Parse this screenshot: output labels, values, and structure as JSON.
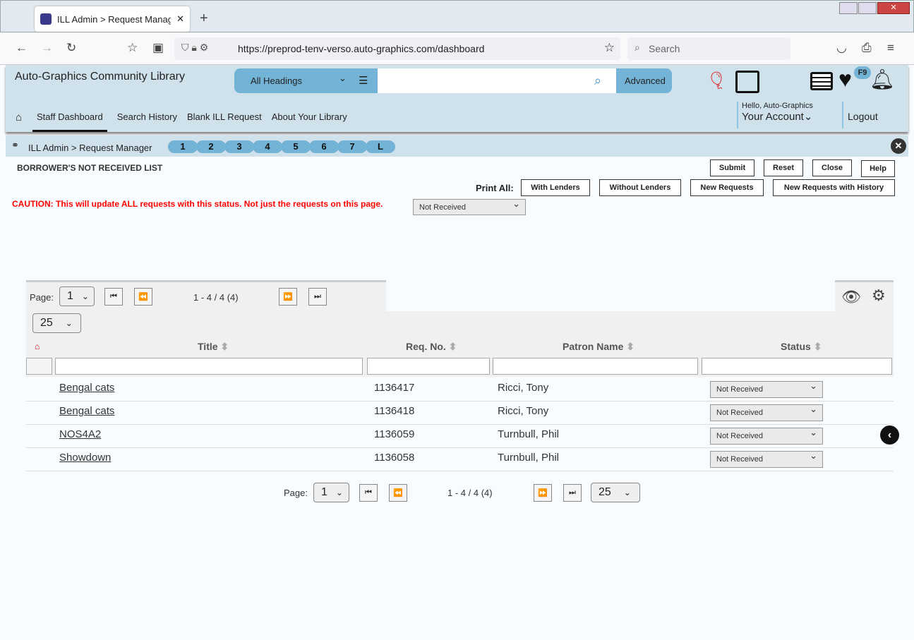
{
  "browser": {
    "tab_title": "ILL Admin > Request Manager |",
    "url": "https://preprod-tenv-verso.auto-graphics.com/dashboard",
    "search_placeholder": "Search"
  },
  "header": {
    "library_name": "Auto-Graphics Community Library",
    "search_scope": "All Headings",
    "advanced_label": "Advanced",
    "badge": "F9",
    "greeting": "Hello, Auto-Graphics",
    "account_label": "Your Account",
    "logout_label": "Logout"
  },
  "nav": {
    "items": [
      "Staff Dashboard",
      "Search History",
      "Blank ILL Request",
      "About Your Library"
    ]
  },
  "breadcrumb": {
    "text": "ILL Admin > Request Manager",
    "pills": [
      "1",
      "2",
      "3",
      "4",
      "5",
      "6",
      "7",
      "L"
    ]
  },
  "page": {
    "title": "BORROWER'S NOT RECEIVED LIST",
    "caution": "CAUTION: This will update ALL requests with this status. Not just the requests on this page.",
    "bulk_status": "Not Received",
    "buttons": {
      "submit": "Submit",
      "reset": "Reset",
      "close": "Close",
      "help": "Help"
    },
    "print_all_label": "Print All:",
    "print_buttons": [
      "With Lenders",
      "Without Lenders",
      "New Requests",
      "New Requests with History"
    ]
  },
  "pager": {
    "page_label": "Page:",
    "page": "1",
    "range": "1 - 4 / 4 (4)",
    "per_page": "25"
  },
  "table": {
    "columns": [
      "Title",
      "Req. No.",
      "Patron Name",
      "Status"
    ],
    "rows": [
      {
        "title": "Bengal cats",
        "req_no": "1136417",
        "patron": "Ricci, Tony",
        "status": "Not Received"
      },
      {
        "title": "Bengal cats",
        "req_no": "1136418",
        "patron": "Ricci, Tony",
        "status": "Not Received"
      },
      {
        "title": "NOS4A2",
        "req_no": "1136059",
        "patron": "Turnbull, Phil",
        "status": "Not Received"
      },
      {
        "title": "Showdown",
        "req_no": "1136058",
        "patron": "Turnbull, Phil",
        "status": "Not Received"
      }
    ]
  },
  "colors": {
    "header_bg": "#cfe2ec",
    "accent": "#72b3d6",
    "caution": "#ff0000"
  }
}
